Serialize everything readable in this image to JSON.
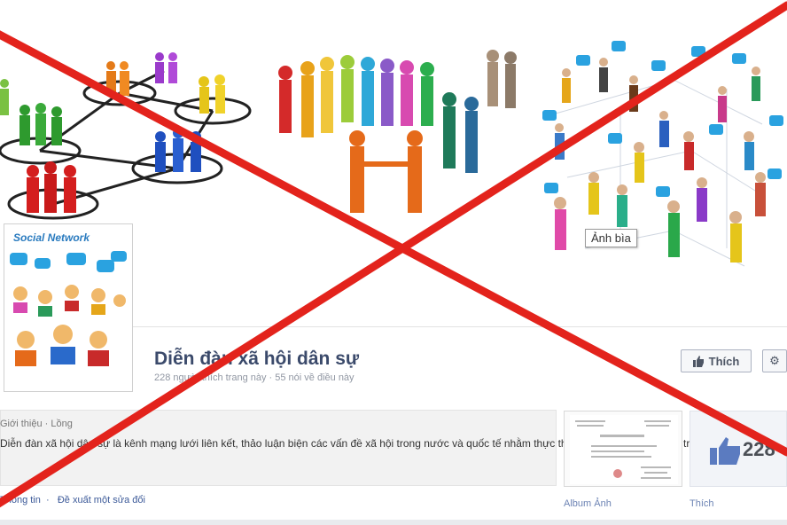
{
  "cover": {
    "badge": "Ảnh bìa"
  },
  "profile": {
    "image_label": "Social Network"
  },
  "header": {
    "title": "Diễn đàn xã hội dân sự",
    "stats": "228 người thích trang này · 55 nói về điều này",
    "like_label": "Thích",
    "settings_icon": "gear-icon"
  },
  "about": {
    "heading": "Giới thiệu · Lồng",
    "text": "Diễn đàn xã hội dân sự là kênh mạng lưới liên kết, thảo luận biện các vấn đề xã hội trong nước và quốc tế nhằm thực thi quyền dân sự và chính trị.",
    "links": [
      "Thông tin",
      "Đề xuất một sửa đổi"
    ]
  },
  "sidebar": {
    "album_label": "Album Ảnh",
    "likes_count": "228",
    "likes_label": "Thích"
  },
  "overlay": {
    "color": "#e3231c"
  }
}
